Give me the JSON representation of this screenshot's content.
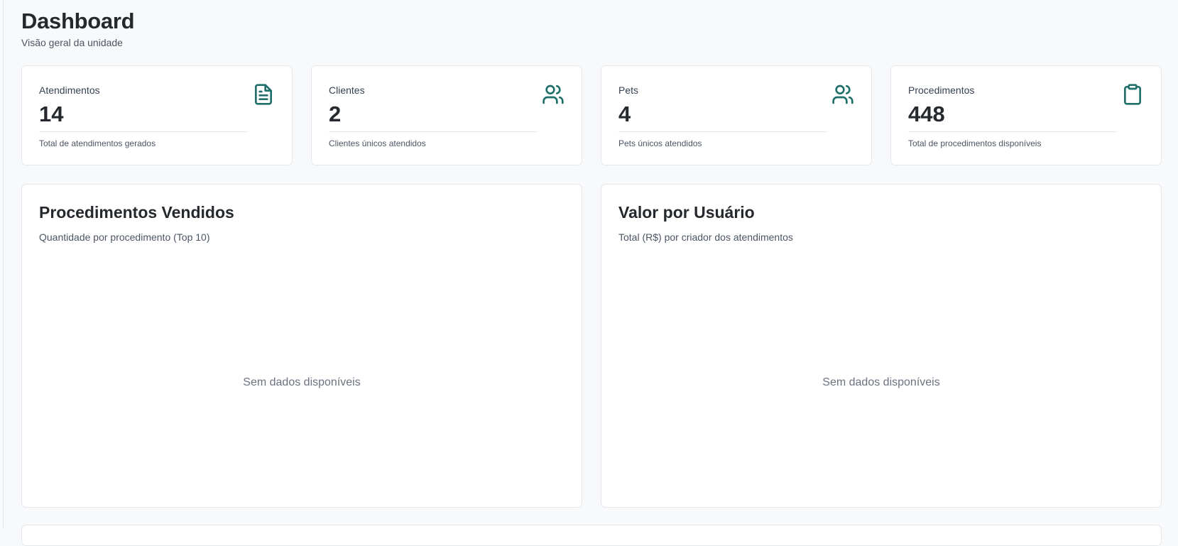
{
  "header": {
    "title": "Dashboard",
    "subtitle": "Visão geral da unidade"
  },
  "stats": [
    {
      "label": "Atendimentos",
      "value": "14",
      "note": "Total de atendimentos gerados",
      "icon": "document-icon"
    },
    {
      "label": "Clientes",
      "value": "2",
      "note": "Clientes únicos atendidos",
      "icon": "users-icon"
    },
    {
      "label": "Pets",
      "value": "4",
      "note": "Pets únicos atendidos",
      "icon": "users-icon"
    },
    {
      "label": "Procedimentos",
      "value": "448",
      "note": "Total de procedimentos disponíveis",
      "icon": "clipboard-icon"
    }
  ],
  "charts": [
    {
      "title": "Procedimentos Vendidos",
      "subtitle": "Quantidade por procedimento (Top 10)",
      "empty_text": "Sem dados disponíveis"
    },
    {
      "title": "Valor por Usuário",
      "subtitle": "Total (R$) por criador dos atendimentos",
      "empty_text": "Sem dados disponíveis"
    }
  ],
  "colors": {
    "accent": "#1f6f6b",
    "background": "#f8f9fa",
    "card": "#ffffff",
    "border": "#e5e7eb"
  }
}
